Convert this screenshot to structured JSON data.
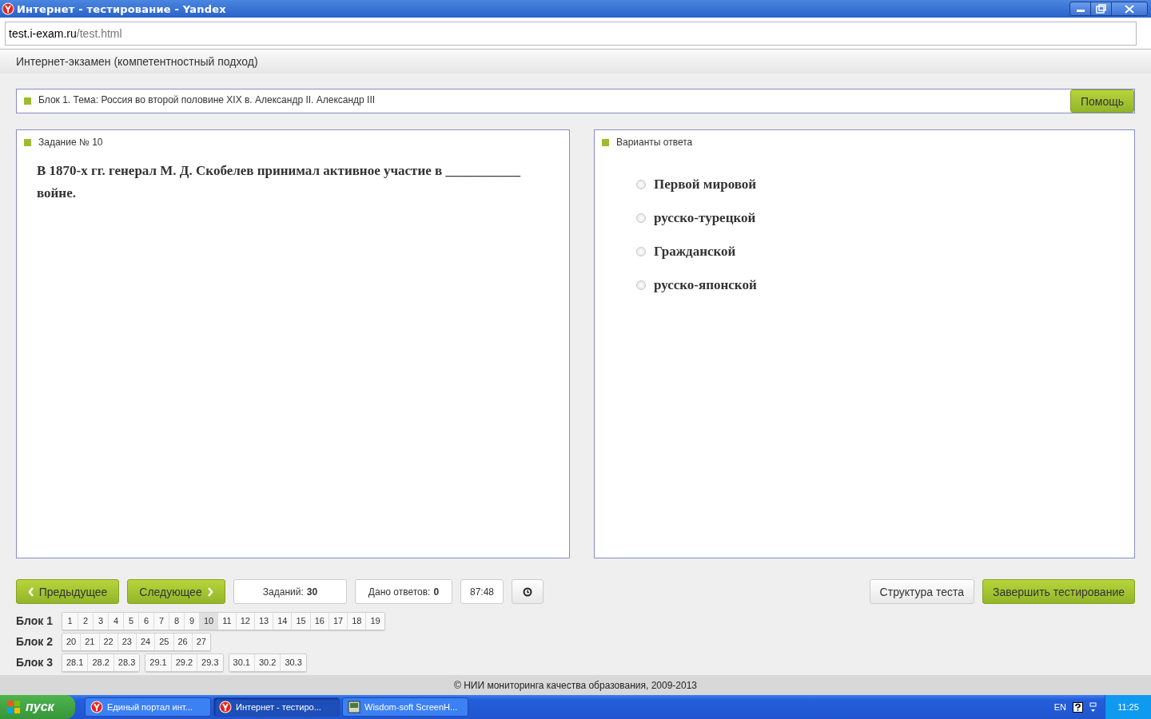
{
  "window": {
    "title": "Интернет - тестирование - Yandex"
  },
  "address_bar": {
    "host": "test.i-exam.ru",
    "path": "/test.html"
  },
  "page_header": "Интернет-экзамен (компетентностный подход)",
  "topic_bar": {
    "text": "Блок 1. Тема: Россия во второй половине XIX в. Александр II. Александр III",
    "help_button": "Помощь"
  },
  "task_panel": {
    "title": "Задание № 10",
    "question": "В 1870-х гг. генерал М. Д. Скобелев принимал активное участие в ___________ войне."
  },
  "answers_panel": {
    "title": "Варианты ответа",
    "options": [
      {
        "label": "Первой мировой",
        "selected": false
      },
      {
        "label": "русско-турецкой",
        "selected": false
      },
      {
        "label": "Гражданской",
        "selected": false
      },
      {
        "label": "русско-японской",
        "selected": false
      }
    ]
  },
  "toolbar": {
    "prev_button": "Предыдущее",
    "next_button": "Следующее",
    "tasks_label": "Заданий:",
    "tasks_count": "30",
    "answered_label": "Дано ответов:",
    "answered_count": "0",
    "timer": "87:48",
    "structure_button": "Структура теста",
    "finish_button": "Завершить тестирование"
  },
  "navigation": [
    {
      "label": "Блок 1",
      "groups": [
        [
          {
            "number": "1",
            "selected": false
          },
          {
            "number": "2",
            "selected": false
          },
          {
            "number": "3",
            "selected": false
          },
          {
            "number": "4",
            "selected": false
          },
          {
            "number": "5",
            "selected": false
          },
          {
            "number": "6",
            "selected": false
          },
          {
            "number": "7",
            "selected": false
          },
          {
            "number": "8",
            "selected": false
          },
          {
            "number": "9",
            "selected": false
          },
          {
            "number": "10",
            "selected": true
          },
          {
            "number": "11",
            "selected": false
          },
          {
            "number": "12",
            "selected": false
          },
          {
            "number": "13",
            "selected": false
          },
          {
            "number": "14",
            "selected": false
          },
          {
            "number": "15",
            "selected": false
          },
          {
            "number": "16",
            "selected": false
          },
          {
            "number": "17",
            "selected": false
          },
          {
            "number": "18",
            "selected": false
          },
          {
            "number": "19",
            "selected": false
          }
        ]
      ]
    },
    {
      "label": "Блок 2",
      "groups": [
        [
          {
            "number": "20",
            "selected": false
          },
          {
            "number": "21",
            "selected": false
          },
          {
            "number": "22",
            "selected": false
          },
          {
            "number": "23",
            "selected": false
          },
          {
            "number": "24",
            "selected": false
          },
          {
            "number": "25",
            "selected": false
          },
          {
            "number": "26",
            "selected": false
          },
          {
            "number": "27",
            "selected": false
          }
        ]
      ]
    },
    {
      "label": "Блок 3",
      "groups": [
        [
          {
            "number": "28.1",
            "selected": false
          },
          {
            "number": "28.2",
            "selected": false
          },
          {
            "number": "28.3",
            "selected": false
          }
        ],
        [
          {
            "number": "29.1",
            "selected": false
          },
          {
            "number": "29.2",
            "selected": false
          },
          {
            "number": "29.3",
            "selected": false
          }
        ],
        [
          {
            "number": "30.1",
            "selected": false
          },
          {
            "number": "30.2",
            "selected": false
          },
          {
            "number": "30.3",
            "selected": false
          }
        ]
      ]
    }
  ],
  "footer": "© НИИ мониторинга качества образования, 2009-2013",
  "taskbar": {
    "start_button": "пуск",
    "tasks": [
      {
        "label": "Единый портал инт...",
        "kind": "browser",
        "selected": false
      },
      {
        "label": "Интернет - тестиро...",
        "kind": "browser",
        "selected": true
      },
      {
        "label": "Wisdom-soft ScreenH...",
        "kind": "app",
        "selected": false
      }
    ],
    "language": "EN",
    "clock": "11:25"
  }
}
